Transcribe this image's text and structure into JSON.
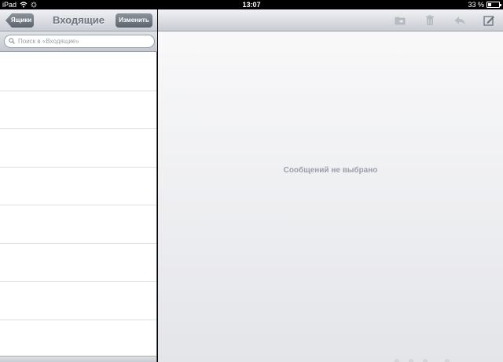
{
  "status_bar": {
    "device": "iPad",
    "time": "13:07",
    "battery_text": "33 %",
    "battery_level": 0.33
  },
  "left_pane": {
    "back_label": "Ящики",
    "title": "Входящие",
    "edit_label": "Изменить",
    "search_placeholder": "Поиск в «Входящие»",
    "row_count": 8
  },
  "right_pane": {
    "toolbar_icons": [
      "folder-move-icon",
      "trash-icon",
      "reply-icon",
      "compose-icon"
    ],
    "empty_message": "Сообщений не выбрано"
  },
  "colors": {
    "toolbar_gray": "#c9ccd3",
    "button_gray": "#6b737d",
    "placeholder_text": "#9aa0a8"
  }
}
